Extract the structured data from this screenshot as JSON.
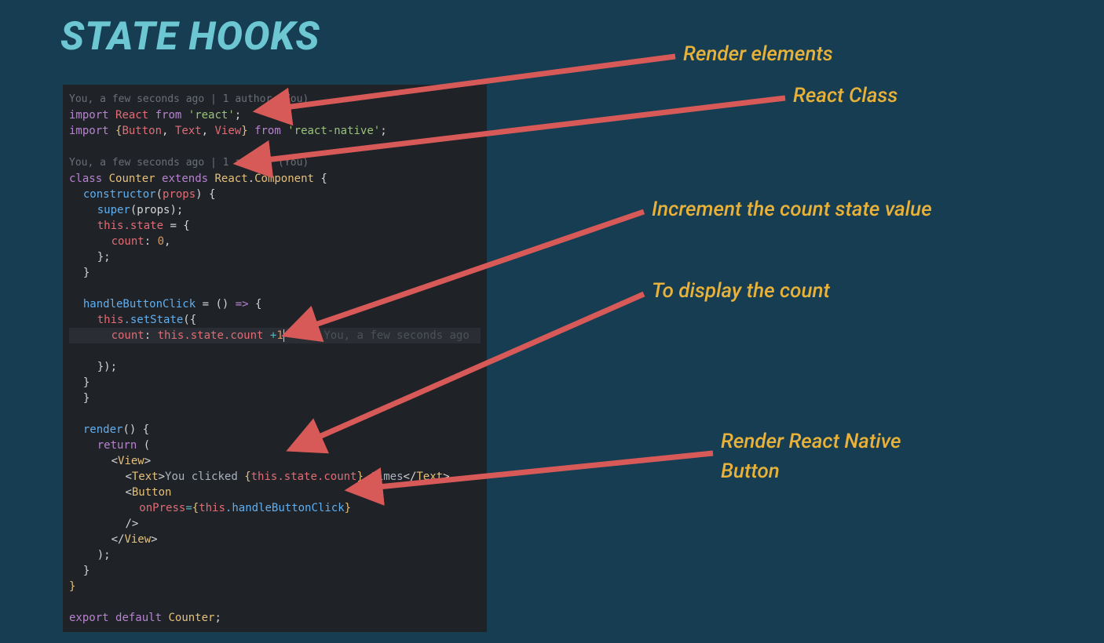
{
  "title": "STATE HOOKS",
  "annotations": {
    "render_elements": "Render elements",
    "react_class": "React Class",
    "increment_count": "Increment the count state value",
    "display_count": "To display the count",
    "render_button_line1": "Render React Native",
    "render_button_line2": "Button"
  },
  "code": {
    "gitlens1": "You, a few seconds ago | 1 author (You)",
    "line1_import": "import",
    "line1_react": "React",
    "line1_from": "from",
    "line1_reactpkg": "'react'",
    "line1_semi": ";",
    "line2_import": "import",
    "line2_brace_open": "{",
    "line2_button": "Button",
    "line2_comma1": ", ",
    "line2_text": "Text",
    "line2_comma2": ", ",
    "line2_view": "View",
    "line2_brace_close": "}",
    "line2_from": "from",
    "line2_rnpkg": "'react-native'",
    "line2_semi": ";",
    "gitlens2": "You, a few seconds ago | 1 author (You)",
    "line3_class": "class",
    "line3_counter": "Counter",
    "line3_extends": "extends",
    "line3_react": "React",
    "line3_dot": ".",
    "line3_component": "Component",
    "line3_brace": " {",
    "line4_constructor": "constructor",
    "line4_parens": "(",
    "line4_props": "props",
    "line4_parens2": ") {",
    "line5_super": "super",
    "line5_props": "(props);",
    "line6_this": "this",
    "line6_state": ".state",
    "line6_eq": " = {",
    "line7_countkey": "count",
    "line7_colon": ": ",
    "line7_zero": "0",
    "line7_comma": ",",
    "line8_close": "};",
    "line9_close": "}",
    "line10_handler": "handleButtonClick",
    "line10_eq": " = () ",
    "line10_arrow": "=>",
    "line10_brace": " {",
    "line11_this": "this",
    "line11_setstate": ".setState",
    "line11_paren": "({",
    "line12_count": "count",
    "line12_colon": ": ",
    "line12_this": "this",
    "line12_state": ".state.count ",
    "line12_plus": "+",
    "line12_one": "1",
    "line12_hint": "You, a few seconds ago",
    "line13_close": "});",
    "line14_close": "}",
    "line14b_close": "}",
    "line15_render": "render",
    "line15_parens": "() {",
    "line16_return": "return",
    "line16_paren": " (",
    "line17_view_open": "<",
    "line17_view": "View",
    "line17_view_close": ">",
    "line18_text_open": "<",
    "line18_text": "Text",
    "line18_text_close": ">",
    "line18_youclicked": "You clicked ",
    "line18_expr_open": "{",
    "line18_this": "this",
    "line18_statecount": ".state.count",
    "line18_expr_close": "}",
    "line18_times": " times",
    "line18_textend_open": "</",
    "line18_textend": "Text",
    "line18_textend_close": ">",
    "line19_button_open": "<",
    "line19_button": "Button",
    "line20_onpress": "onPress",
    "line20_eq": "=",
    "line20_brace_open": "{",
    "line20_this": "this",
    "line20_handler": ".handleButtonClick",
    "line20_brace_close": "}",
    "line21_selfclose": "/>",
    "line22_viewend_open": "</",
    "line22_viewend": "View",
    "line22_viewend_close": ">",
    "line23_paren": ");",
    "line24_close": "}",
    "line25_close": "}",
    "line26_export": "export",
    "line26_default": "default",
    "line26_counter": "Counter",
    "line26_semi": ";"
  },
  "colors": {
    "background": "#163d52",
    "title": "#6cc7d3",
    "annotation": "#e8b23a",
    "arrow": "#d85a58"
  }
}
